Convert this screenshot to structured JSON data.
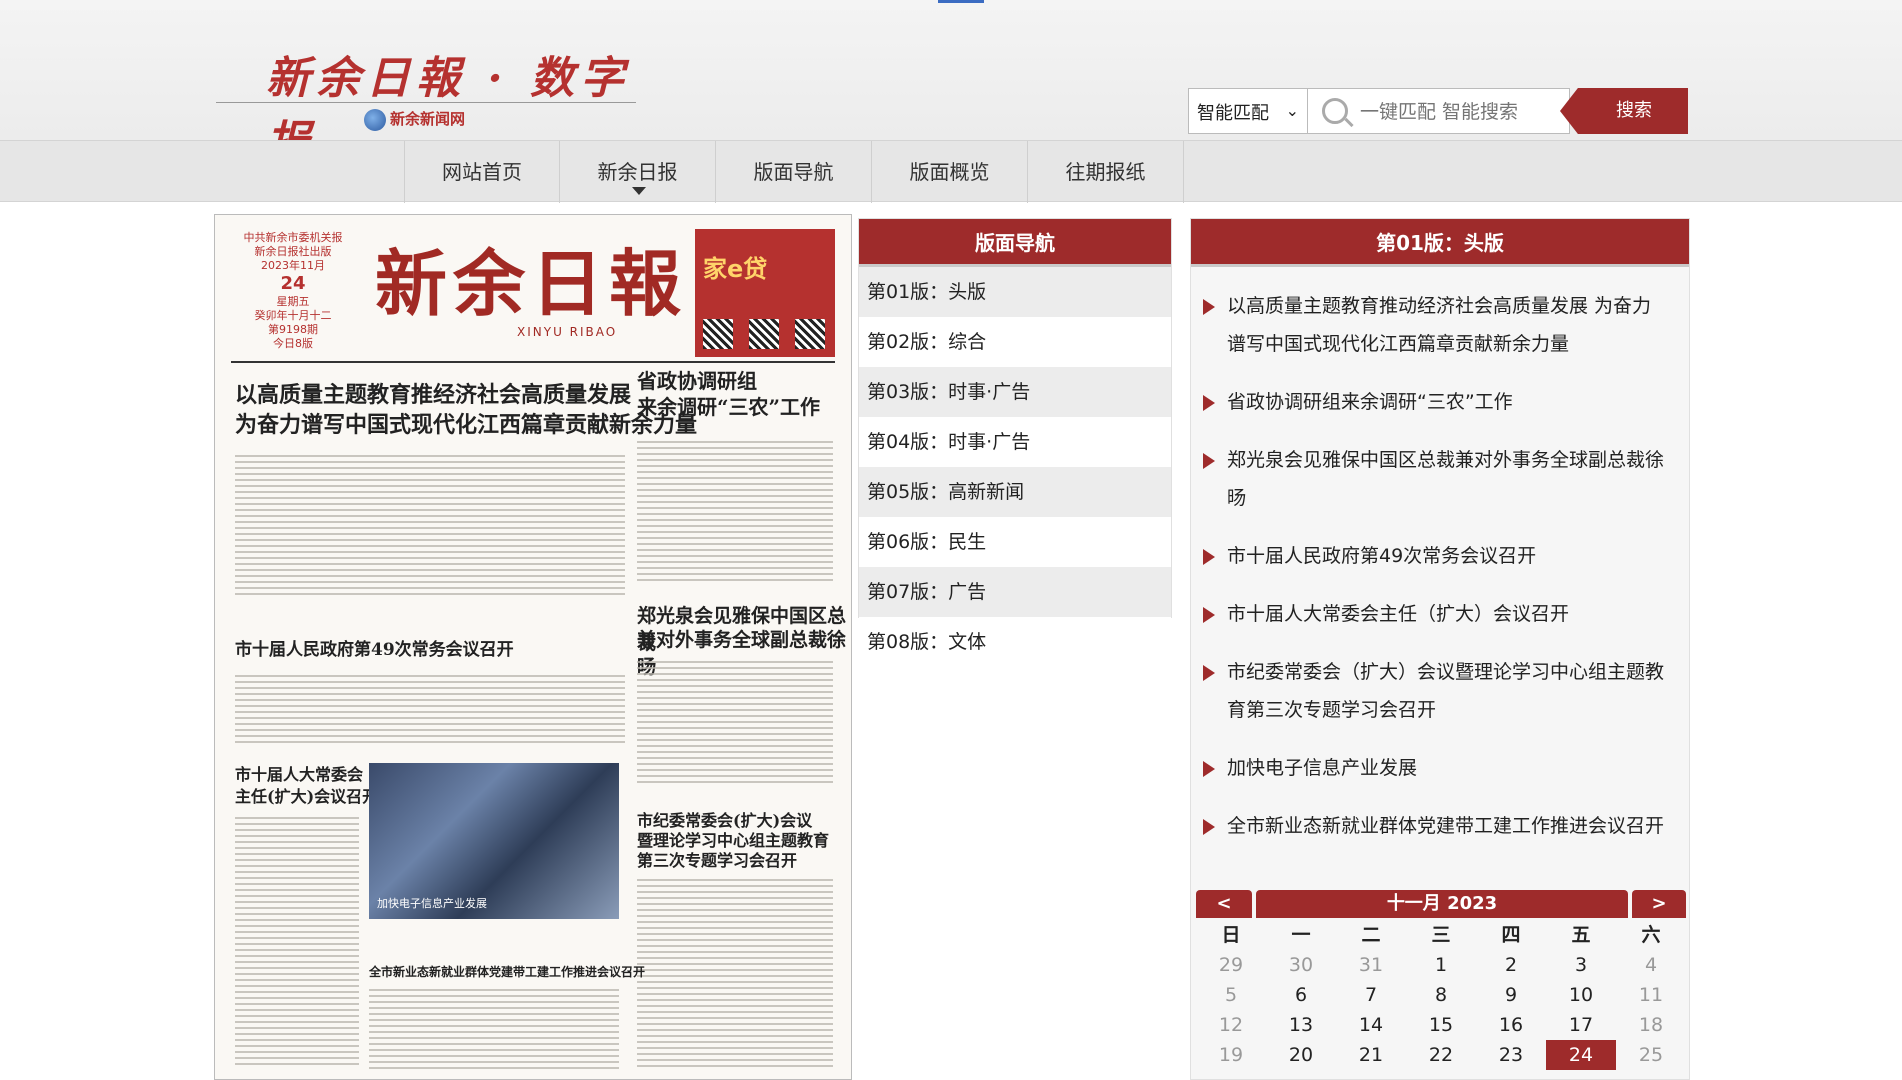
{
  "brand": {
    "title": "新余日報 · 数字报",
    "subtitle": "新余新闻网"
  },
  "search": {
    "mode_selected": "智能匹配",
    "placeholder": "一键匹配 智能搜索",
    "button_label": "搜索"
  },
  "nav": {
    "items": [
      "网站首页",
      "新余日报",
      "版面导航",
      "版面概览",
      "往期报纸"
    ],
    "active_index": 1
  },
  "newspaper": {
    "masthead": "新余日報",
    "masthead_pinyin": "XINYU RIBAO",
    "issuer_lines": [
      "中共新余市委机关报",
      "新余日报社出版",
      "2023年11月"
    ],
    "day": "24",
    "weekday_lines": [
      "星期五",
      "癸卯年十月十二",
      "第9198期",
      "今日8版"
    ],
    "ad_text": "家e贷",
    "headlines": [
      "以高质量主题教育推经济社会高质量发展",
      "为奋力谱写中国式现代化江西篇章贡献新余力量",
      "省政协调研组",
      "来余调研“三农”工作",
      "郑光泉会见雅保中国区总裁",
      "兼对外事务全球副总裁徐旸",
      "市十届人民政府第49次常务会议召开",
      "市十届人大常委会",
      "主任(扩大)会议召开",
      "市纪委常委会(扩大)会议",
      "暨理论学习中心组主题教育",
      "第三次专题学习会召开",
      "全市新业态新就业群体党建带工建工作推进会议召开"
    ],
    "photo_caption": "加快电子信息产业发展"
  },
  "section_nav": {
    "title": "版面导航",
    "items": [
      "第01版：头版",
      "第02版：综合",
      "第03版：时事·广告",
      "第04版：时事·广告",
      "第05版：高新新闻",
      "第06版：民生",
      "第07版：广告",
      "第08版：文体"
    ]
  },
  "articles": {
    "title": "第01版：头版",
    "items": [
      "以高质量主题教育推动经济社会高质量发展 为奋力谱写中国式现代化江西篇章贡献新余力量",
      "省政协调研组来余调研“三农”工作",
      "郑光泉会见雅保中国区总裁兼对外事务全球副总裁徐旸",
      "市十届人民政府第49次常务会议召开",
      "市十届人大常委会主任（扩大）会议召开",
      "市纪委常委会（扩大）会议暨理论学习中心组主题教育第三次专题学习会召开",
      "加快电子信息产业发展",
      "全市新业态新就业群体党建带工建工作推进会议召开"
    ]
  },
  "calendar": {
    "prev_label": "<",
    "next_label": ">",
    "title": "十一月 2023",
    "weekdays": [
      "日",
      "一",
      "二",
      "三",
      "四",
      "五",
      "六"
    ],
    "weeks": [
      [
        "29",
        "30",
        "31",
        "1",
        "2",
        "3",
        "4"
      ],
      [
        "5",
        "6",
        "7",
        "8",
        "9",
        "10",
        "11"
      ],
      [
        "12",
        "13",
        "14",
        "15",
        "16",
        "17",
        "18"
      ],
      [
        "19",
        "20",
        "21",
        "22",
        "23",
        "24",
        "25"
      ]
    ],
    "selected_day": "24",
    "colors": {
      "accent": "#9e2b2b"
    }
  }
}
